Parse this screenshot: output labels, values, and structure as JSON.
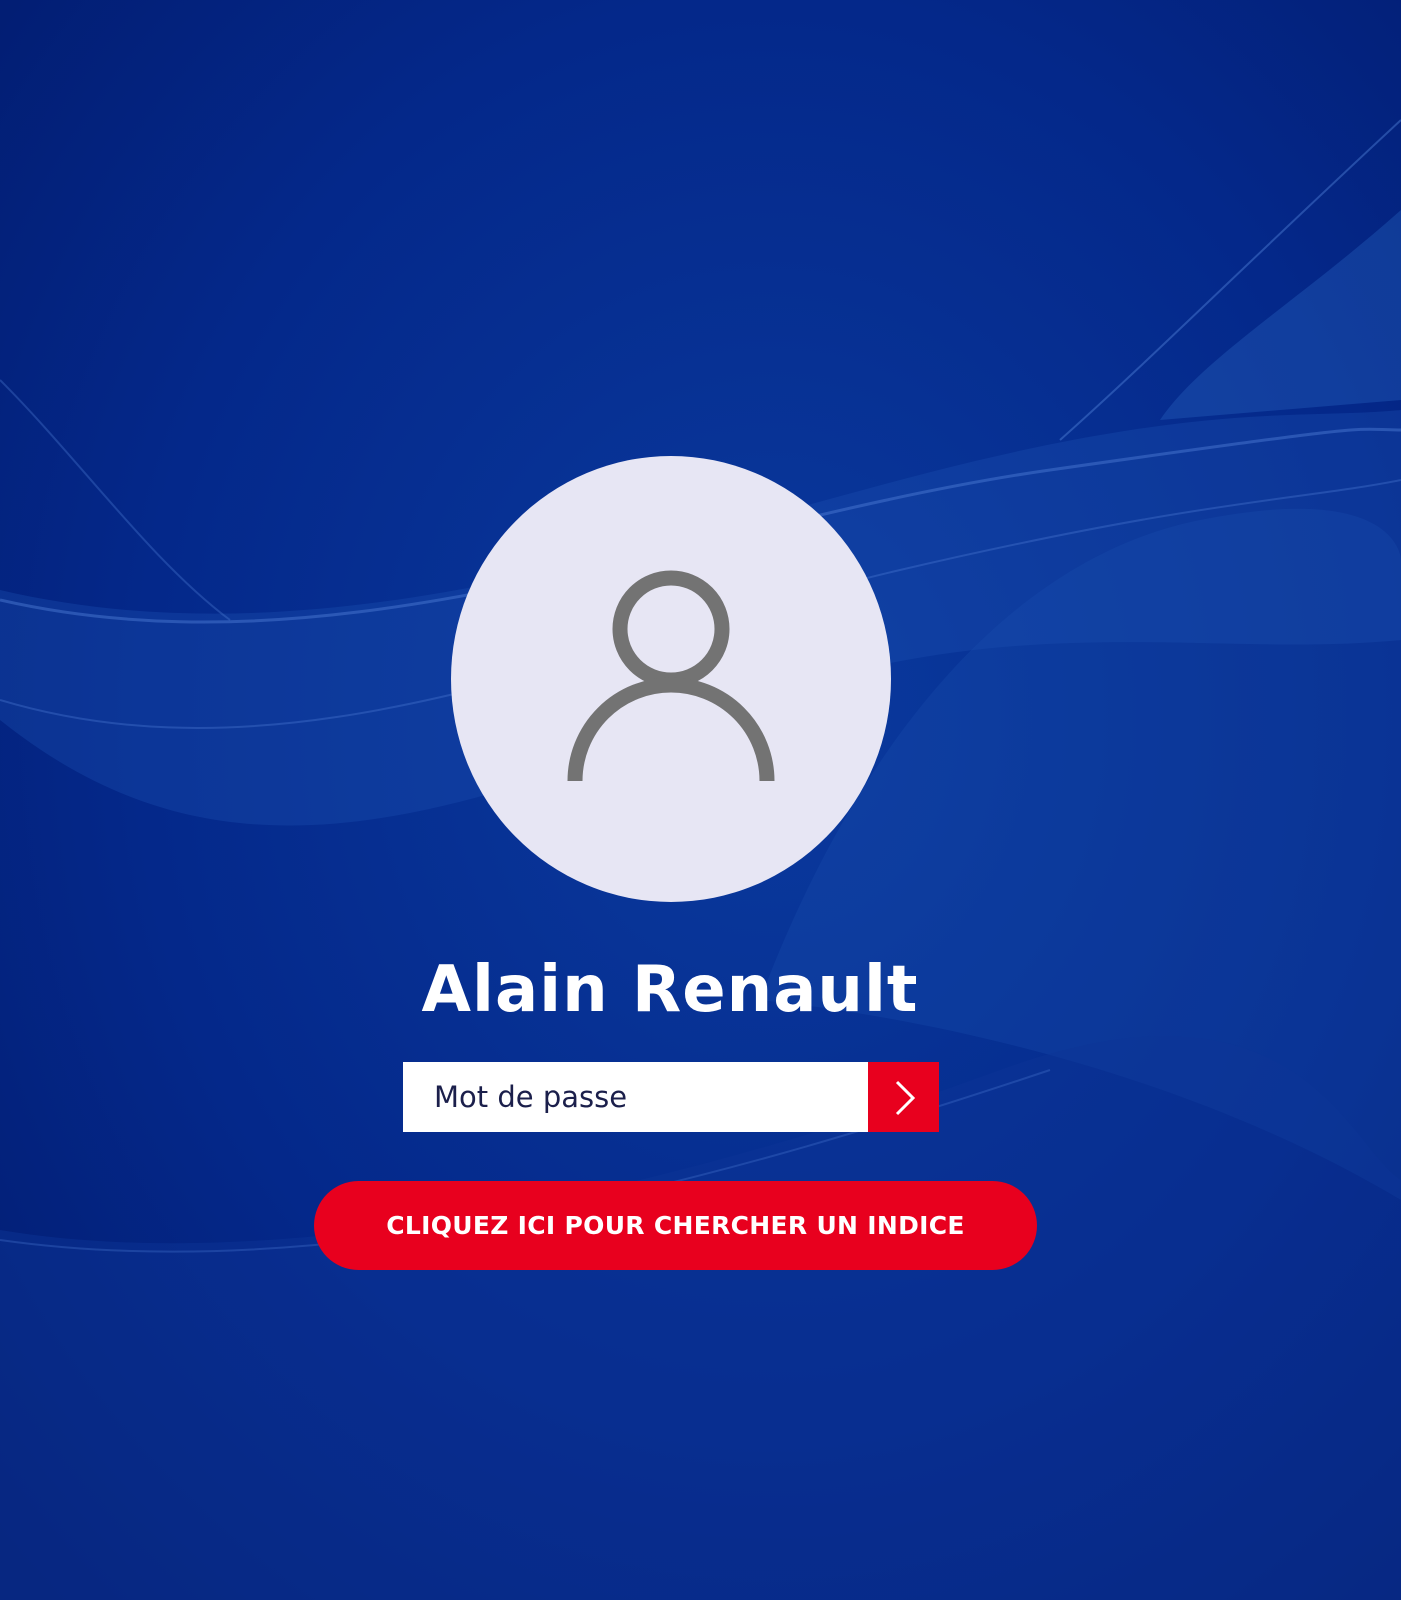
{
  "user": {
    "name": "Alain Renault",
    "avatar_icon": "user-icon"
  },
  "login": {
    "password_placeholder": "Mot de passe",
    "submit_icon": "chevron-right-icon"
  },
  "hint": {
    "button_label": "CLIQUEZ ICI POUR CHERCHER UN INDICE"
  },
  "colors": {
    "background": "#03247e",
    "accent_red": "#e8001e",
    "avatar_bg": "#e7e6f4",
    "avatar_icon": "#737373",
    "text_white": "#ffffff"
  }
}
